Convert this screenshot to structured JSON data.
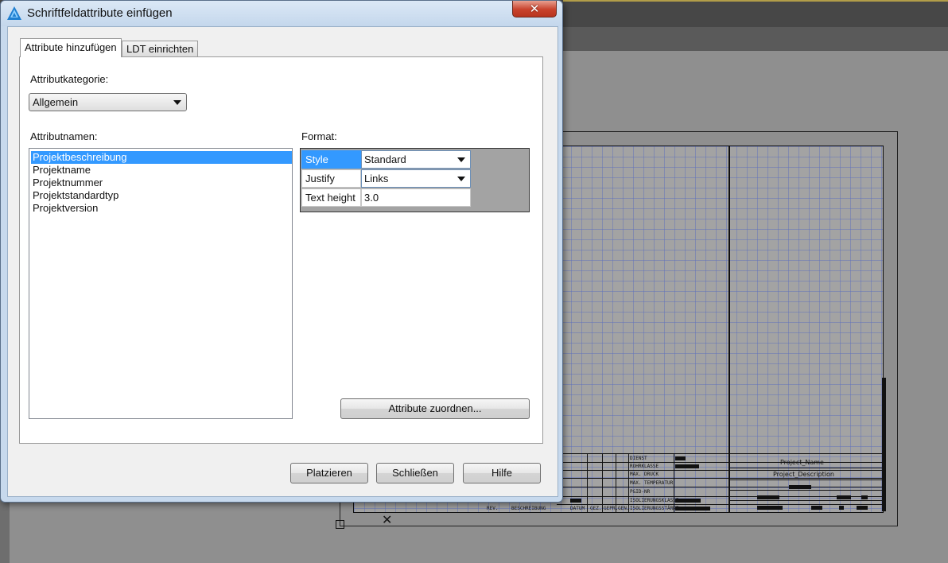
{
  "dialog": {
    "title": "Schriftfeldattribute einfügen",
    "close_glyph": "✕",
    "tabs": [
      {
        "label": "Attribute hinzufügen",
        "active": true
      },
      {
        "label": "LDT einrichten",
        "active": false
      }
    ],
    "category": {
      "label": "Attributkategorie:",
      "selected": "Allgemein"
    },
    "attribute_names": {
      "label": "Attributnamen:",
      "items": [
        "Projektbeschreibung",
        "Projektname",
        "Projektnummer",
        "Projektstandardtyp",
        "Projektversion"
      ],
      "selected_index": 0
    },
    "format": {
      "label": "Format:",
      "rows": [
        {
          "name": "Style",
          "value": "Standard",
          "dropdown": true
        },
        {
          "name": "Justify",
          "value": "Links",
          "dropdown": true
        },
        {
          "name": "Text height",
          "value": "3.0",
          "dropdown": false
        }
      ]
    },
    "assign_button": "Attribute zuordnen...",
    "footer": {
      "place": "Platzieren",
      "close": "Schließen",
      "help": "Hilfe"
    }
  },
  "drawing": {
    "title_block": {
      "labels": [
        "DIENST",
        "ROHRKLASSE",
        "MAX. DRUCK",
        "MAX. TEMPERATUR",
        "P&ID-NR",
        "ISOLIERUNGSKLASSE",
        "ISOLIERUNGSSTÄRKE"
      ],
      "bottom_labels": [
        "REV.",
        "BESCHREIBUNG",
        "DATUM",
        "GEZ.",
        "GEPR.",
        "GEN."
      ],
      "project_name": "Project_Name",
      "project_description": "Project_Description"
    }
  },
  "colors": {
    "selection": "#3399ff",
    "close_button": "#c8422c",
    "dialog_frame": "#c7d9ed"
  }
}
